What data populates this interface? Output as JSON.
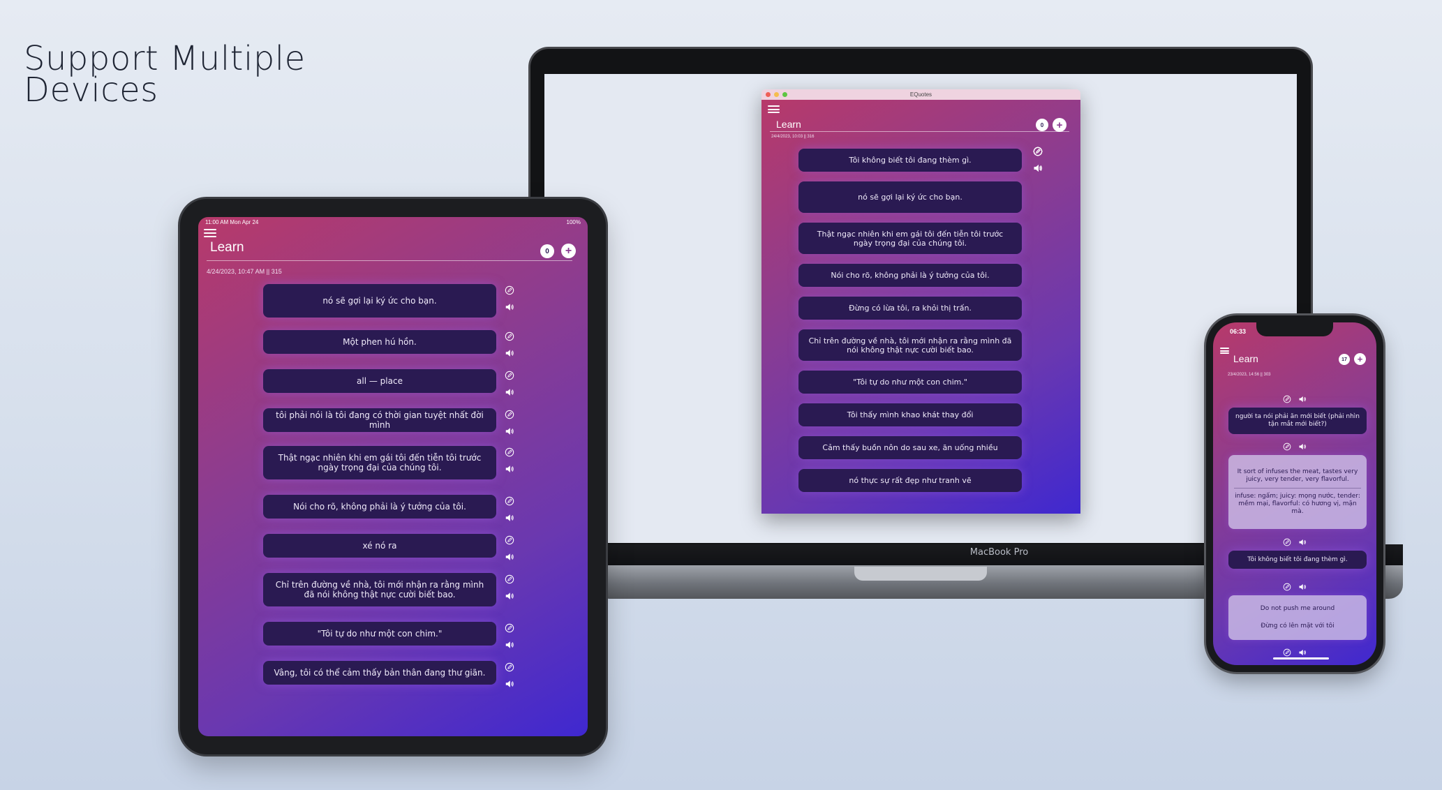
{
  "headline": {
    "line1": "Support Multiple",
    "line2": "Devices"
  },
  "ipad": {
    "status_time": "11:00 AM   Mon Apr 24",
    "status_battery": "100%",
    "title": "Learn",
    "count": "0",
    "meta": "4/24/2023, 10:47 AM || 315",
    "items": [
      "nó sẽ gợi lại ký ức cho bạn.",
      "Một phen hú hồn.",
      "all — place",
      "tôi phải nói là tôi đang có thời gian tuyệt nhất đời mình",
      "Thật ngạc nhiên khi em gái tôi đến tiễn tôi trước ngày trọng đại của chúng tôi.",
      "Nói cho rõ, không phải là ý tưởng của tôi.",
      "xé nó ra",
      "Chỉ trên đường về nhà, tôi mới nhận ra rằng mình đã nói không thật nực cười biết bao.",
      "\"Tôi tự do như một con chim.\"",
      "Vâng, tôi có thể cảm thấy bản thân đang thư giãn."
    ]
  },
  "macbook": {
    "label": "MacBook Pro",
    "window_title": "EQuotes",
    "title": "Learn",
    "count": "0",
    "meta": "24/4/2023, 10:03 || 316",
    "items": [
      "Tôi không biết tôi đang thèm gì.",
      "nó sẽ gợi lại ký ức cho bạn.",
      "Thật ngạc nhiên khi em gái tôi đến tiễn tôi trước ngày trọng đại của chúng tôi.",
      "Nói cho rõ, không phải là ý tưởng của tôi.",
      "Đừng có lừa tôi, ra khỏi thị trấn.",
      "Chỉ trên đường về nhà, tôi mới nhận ra rằng mình đã nói không thật nực cười biết bao.",
      "\"Tôi tự do như một con chim.\"",
      "Tôi thấy mình khao khát thay đổi",
      "Cảm thấy buồn nôn do sau xe, ăn uống nhiều",
      "nó thực sự rất đẹp như tranh vẽ"
    ]
  },
  "iphone": {
    "time": "06:33",
    "title": "Learn",
    "count": "17",
    "meta": "23/4/2023, 14:56 || 303",
    "card1": "người ta nói phải ăn mới biết (phải nhìn tận mắt mới biết?)",
    "card2_top": "It sort of infuses the meat, tastes very juicy, very tender, very flavorful.",
    "card2_bottom": "infuse: ngấm; juicy: mọng nước, tender: mềm mại, flavorful: có hương vị, mặn mà.",
    "card3": "Tôi không biết tôi đang thèm gì.",
    "card4_top": "Do not push me around",
    "card4_bottom": "Đừng có lên mặt với tôi"
  },
  "icons": {
    "menu": "hamburger-icon",
    "add": "plus-icon",
    "edit": "edit-icon",
    "speak": "speaker-icon"
  },
  "colors": {
    "gradient_top": "#b73a6a",
    "gradient_bottom": "#3f28d0",
    "card": "#2a1a52"
  }
}
